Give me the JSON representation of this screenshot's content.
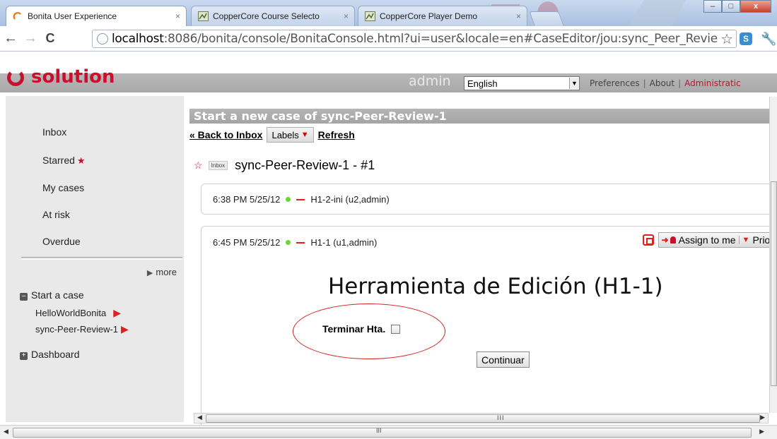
{
  "browser": {
    "tabs": [
      {
        "title": "Bonita User Experience",
        "close": "×",
        "active": true,
        "icon": "bonita-icon"
      },
      {
        "title": "CopperCore Course Selecto",
        "close": "×",
        "active": false,
        "icon": "coppercore-icon"
      },
      {
        "title": "CopperCore Player Demo",
        "close": "×",
        "active": false,
        "icon": "coppercore-icon"
      }
    ],
    "url_host": "localhost",
    "url_rest": ":8086/bonita/console/BonitaConsole.html?ui=user&locale=en#CaseEditor/jou:sync_Peer_Revie",
    "window_controls": {
      "minimize": "–",
      "maximize": "□",
      "close": "x"
    }
  },
  "header": {
    "logo_text": "solution",
    "user": "admin",
    "language": "English",
    "links": {
      "preferences": "Preferences",
      "separator": "|",
      "about": "About",
      "administration": "Administratic"
    }
  },
  "sidebar": {
    "items": [
      "Inbox",
      "Starred",
      "My cases",
      "At risk",
      "Overdue"
    ],
    "more": "more",
    "start_case": {
      "toggle": "–",
      "label": "Start a case",
      "processes": [
        "HelloWorldBonita",
        "sync-Peer-Review-1"
      ]
    },
    "dashboard": {
      "toggle": "+",
      "label": "Dashboard"
    }
  },
  "main": {
    "title": "Start a new case of sync-Peer-Review-1",
    "back_link": "« Back to Inbox",
    "labels_button": "Labels",
    "refresh_link": "Refresh",
    "inbox_badge": "Inbox",
    "case_name": "sync-Peer-Review-1 - #1",
    "steps": [
      {
        "time": "6:38 PM 5/25/12",
        "name": "H1-2-ini (u2,admin)"
      },
      {
        "time": "6:45 PM 5/25/12",
        "name": "H1-1 (u1,admin)"
      }
    ],
    "assign_button": "Assign to me",
    "priority_button": "Prior",
    "form": {
      "title": "Herramienta de Edición (H1-1)",
      "field_label": "Terminar Hta.",
      "continue_button": "Continuar"
    }
  },
  "scrollbar_grip": "III",
  "colors": {
    "brand_red": "#c8102e",
    "accent_red": "#e02020",
    "status_green": "#6cd33b",
    "bar_gray": "#a9a9a9"
  }
}
